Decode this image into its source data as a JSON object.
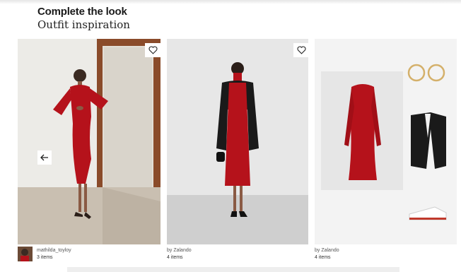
{
  "header": {
    "title": "Complete the look",
    "subtitle": "Outfit inspiration"
  },
  "outfits": [
    {
      "author": "mathilda_toyloy",
      "items_count": "3 items"
    },
    {
      "author": "by Zalando",
      "items_count": "4 items"
    },
    {
      "author": "by Zalando",
      "items_count": "4 items"
    }
  ],
  "icons": {
    "favorite": "heart-icon",
    "previous": "arrow-left-icon"
  },
  "colors": {
    "dress_red": "#b5121b",
    "coat_black": "#1a1a1a",
    "background": "#ffffff"
  }
}
